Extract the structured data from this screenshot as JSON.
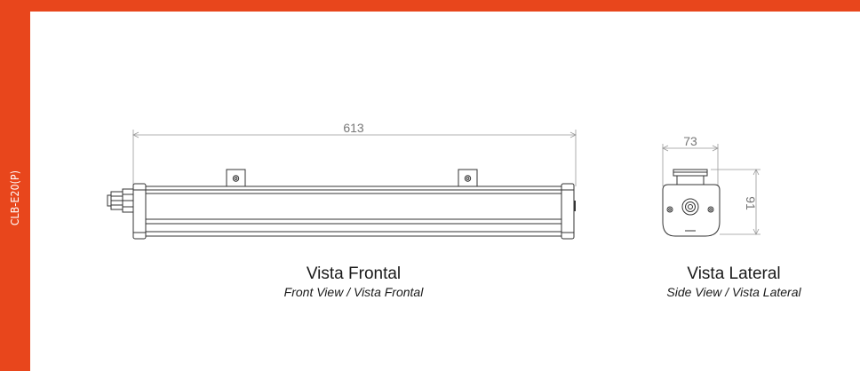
{
  "model_code": "CLB-E20(P)",
  "accent_color": "#e8461c",
  "front_view": {
    "dimension": "613",
    "title": "Vista Frontal",
    "subtitle": "Front View / Vista Frontal"
  },
  "side_view": {
    "width_dimension": "73",
    "height_dimension": "91",
    "title": "Vista Lateral",
    "subtitle": "Side View / Vista Lateral"
  }
}
